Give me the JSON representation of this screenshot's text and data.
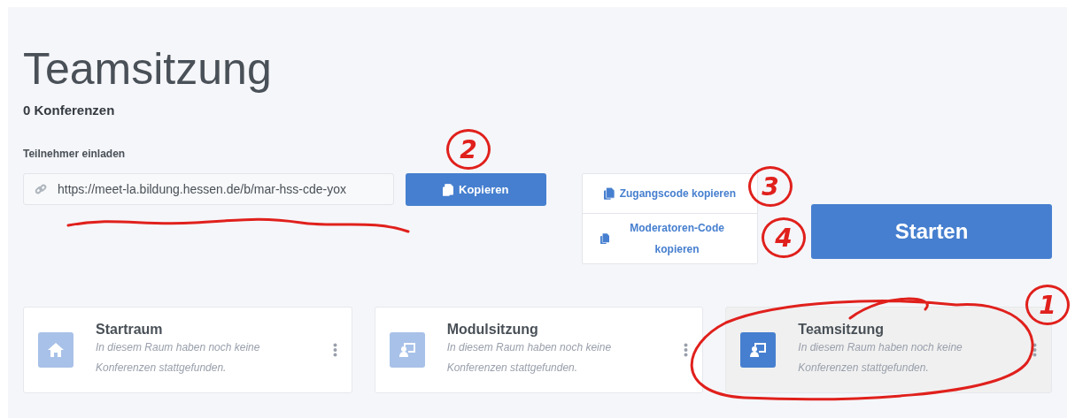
{
  "title": "Teamsitzung",
  "conference_count": "0 Konferenzen",
  "invite": {
    "label": "Teilnehmer einladen",
    "url": "https://meet-la.bildung.hessen.de/b/mar-hss-cde-yox",
    "copy_button": "Kopieren"
  },
  "code_buttons": [
    "Zugangscode kopieren",
    "Moderatoren-Code kopieren"
  ],
  "start_button": "Starten",
  "rooms": [
    {
      "name": "Startraum",
      "description": "In diesem Raum haben noch keine Konferenzen stattgefunden.",
      "kind": "home",
      "selected": false
    },
    {
      "name": "Modulsitzung",
      "description": "In diesem Raum haben noch keine Konferenzen stattgefunden.",
      "kind": "presentation",
      "selected": false
    },
    {
      "name": "Teamsitzung",
      "description": "In diesem Raum haben noch keine Konferenzen stattgefunden.",
      "kind": "presentation",
      "selected": true
    }
  ],
  "annotations": [
    {
      "label": "1"
    },
    {
      "label": "2"
    },
    {
      "label": "3"
    },
    {
      "label": "4"
    }
  ]
}
